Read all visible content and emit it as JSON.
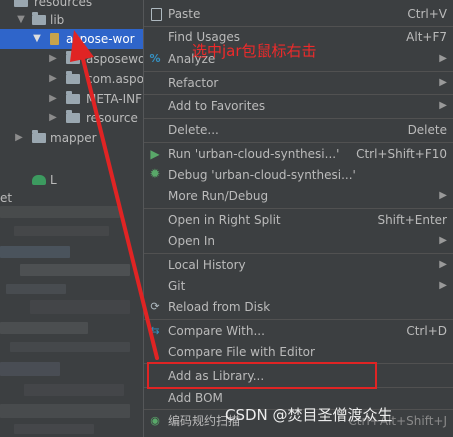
{
  "tree": {
    "items": [
      {
        "label": "resources"
      },
      {
        "label": "lib"
      },
      {
        "label": "aspose-wor"
      },
      {
        "label": "asposewo"
      },
      {
        "label": "com.aspos"
      },
      {
        "label": "META-INF"
      },
      {
        "label": "resource"
      },
      {
        "label": "mapper"
      },
      {
        "label": "L"
      },
      {
        "label": "et"
      }
    ]
  },
  "menu": {
    "items": [
      {
        "label": "Paste",
        "shortcut": "Ctrl+V",
        "icon": "paste-icon"
      },
      {
        "label": "Find Usages",
        "shortcut": "Alt+F7",
        "icon": ""
      },
      {
        "label": "Analyze",
        "shortcut": "",
        "icon": "analyze-icon",
        "submenu": true
      },
      {
        "label": "Refactor",
        "shortcut": "",
        "icon": "",
        "submenu": true
      },
      {
        "label": "Add to Favorites",
        "shortcut": "",
        "icon": "",
        "submenu": true
      },
      {
        "label": "Delete...",
        "shortcut": "Delete",
        "icon": ""
      },
      {
        "label": "Run 'urban-cloud-synthesi...'",
        "shortcut": "Ctrl+Shift+F10",
        "icon": "run-icon"
      },
      {
        "label": "Debug 'urban-cloud-synthesi...'",
        "shortcut": "",
        "icon": "debug-icon"
      },
      {
        "label": "More Run/Debug",
        "shortcut": "",
        "icon": "",
        "submenu": true
      },
      {
        "label": "Open in Right Split",
        "shortcut": "Shift+Enter",
        "icon": ""
      },
      {
        "label": "Open In",
        "shortcut": "",
        "icon": "",
        "submenu": true
      },
      {
        "label": "Local History",
        "shortcut": "",
        "icon": "",
        "submenu": true
      },
      {
        "label": "Git",
        "shortcut": "",
        "icon": "",
        "submenu": true
      },
      {
        "label": "Reload from Disk",
        "shortcut": "",
        "icon": "reload-icon"
      },
      {
        "label": "Compare With...",
        "shortcut": "Ctrl+D",
        "icon": "compare-icon"
      },
      {
        "label": "Compare File with Editor",
        "shortcut": "",
        "icon": ""
      },
      {
        "label": "Add as Library...",
        "shortcut": "",
        "icon": ""
      },
      {
        "label": "Add BOM",
        "shortcut": "",
        "icon": ""
      },
      {
        "label": "编码规约扫描",
        "shortcut": "Ctrl+Alt+Shift+J",
        "icon": "scan-icon"
      }
    ]
  },
  "annotation": {
    "text": "选中jar包鼠标右击"
  },
  "watermark": {
    "text": "CSDN @焚目圣僧渡众生"
  },
  "colors": {
    "accent": "#2f65ca",
    "annotation": "#e02424",
    "run": "#59a869",
    "debug": "#59a869"
  }
}
